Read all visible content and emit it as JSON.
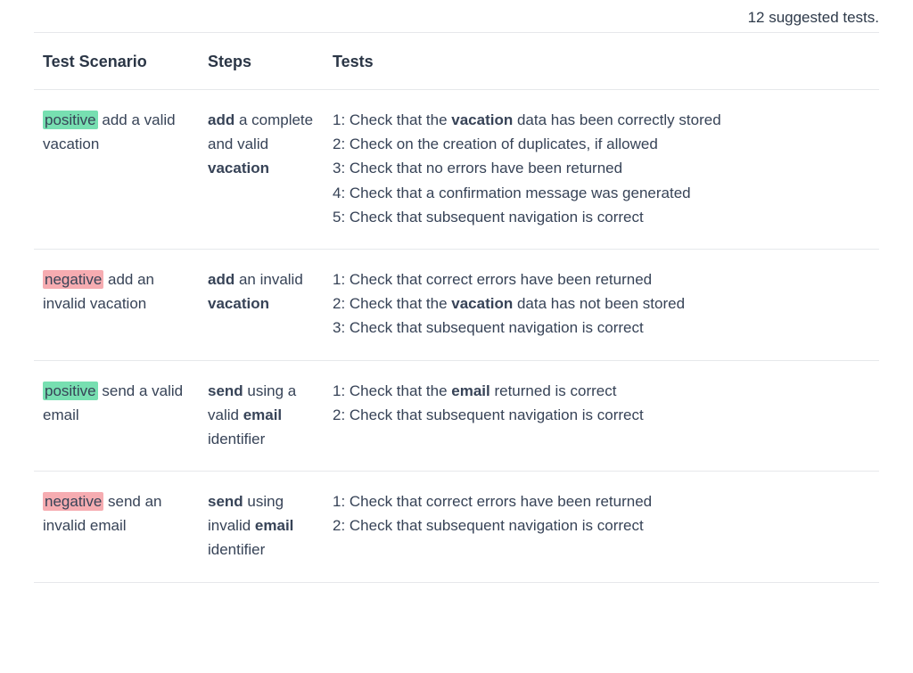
{
  "summary": "12 suggested tests.",
  "headers": {
    "scenario": "Test Scenario",
    "steps": "Steps",
    "tests": "Tests"
  },
  "rows": [
    {
      "tag_type": "positive",
      "scenario": [
        {
          "t": "positive",
          "tag": "positive"
        },
        {
          "t": " add a valid vacation"
        }
      ],
      "steps": [
        {
          "t": "add",
          "b": true
        },
        {
          "t": " a complete and valid "
        },
        {
          "t": "vacation",
          "b": true
        }
      ],
      "tests": [
        [
          {
            "t": "1: Check that the "
          },
          {
            "t": "vacation",
            "b": true
          },
          {
            "t": " data has been correctly stored"
          }
        ],
        [
          {
            "t": "2: Check on the creation of duplicates, if allowed"
          }
        ],
        [
          {
            "t": "3: Check that no errors have been returned"
          }
        ],
        [
          {
            "t": "4: Check that a confirmation message was generated"
          }
        ],
        [
          {
            "t": "5: Check that subsequent navigation is correct"
          }
        ]
      ]
    },
    {
      "tag_type": "negative",
      "scenario": [
        {
          "t": "negative",
          "tag": "negative"
        },
        {
          "t": " add an invalid vacation"
        }
      ],
      "steps": [
        {
          "t": "add",
          "b": true
        },
        {
          "t": " an invalid "
        },
        {
          "t": "vacation",
          "b": true
        }
      ],
      "tests": [
        [
          {
            "t": "1: Check that correct errors have been returned"
          }
        ],
        [
          {
            "t": "2: Check that the "
          },
          {
            "t": "vacation",
            "b": true
          },
          {
            "t": " data has not been stored"
          }
        ],
        [
          {
            "t": "3: Check that subsequent navigation is correct"
          }
        ]
      ]
    },
    {
      "tag_type": "positive",
      "scenario": [
        {
          "t": "positive",
          "tag": "positive"
        },
        {
          "t": " send a valid email"
        }
      ],
      "steps": [
        {
          "t": "send",
          "b": true
        },
        {
          "t": " using a valid "
        },
        {
          "t": "email",
          "b": true
        },
        {
          "t": " identifier"
        }
      ],
      "tests": [
        [
          {
            "t": "1: Check that the "
          },
          {
            "t": "email",
            "b": true
          },
          {
            "t": " returned is correct"
          }
        ],
        [
          {
            "t": "2: Check that subsequent navigation is correct"
          }
        ]
      ]
    },
    {
      "tag_type": "negative",
      "scenario": [
        {
          "t": "negative",
          "tag": "negative"
        },
        {
          "t": " send an invalid email"
        }
      ],
      "steps": [
        {
          "t": "send",
          "b": true
        },
        {
          "t": " using invalid "
        },
        {
          "t": "email",
          "b": true
        },
        {
          "t": " identifier"
        }
      ],
      "tests": [
        [
          {
            "t": "1: Check that correct errors have been returned"
          }
        ],
        [
          {
            "t": "2: Check that subsequent navigation is correct"
          }
        ]
      ]
    }
  ]
}
